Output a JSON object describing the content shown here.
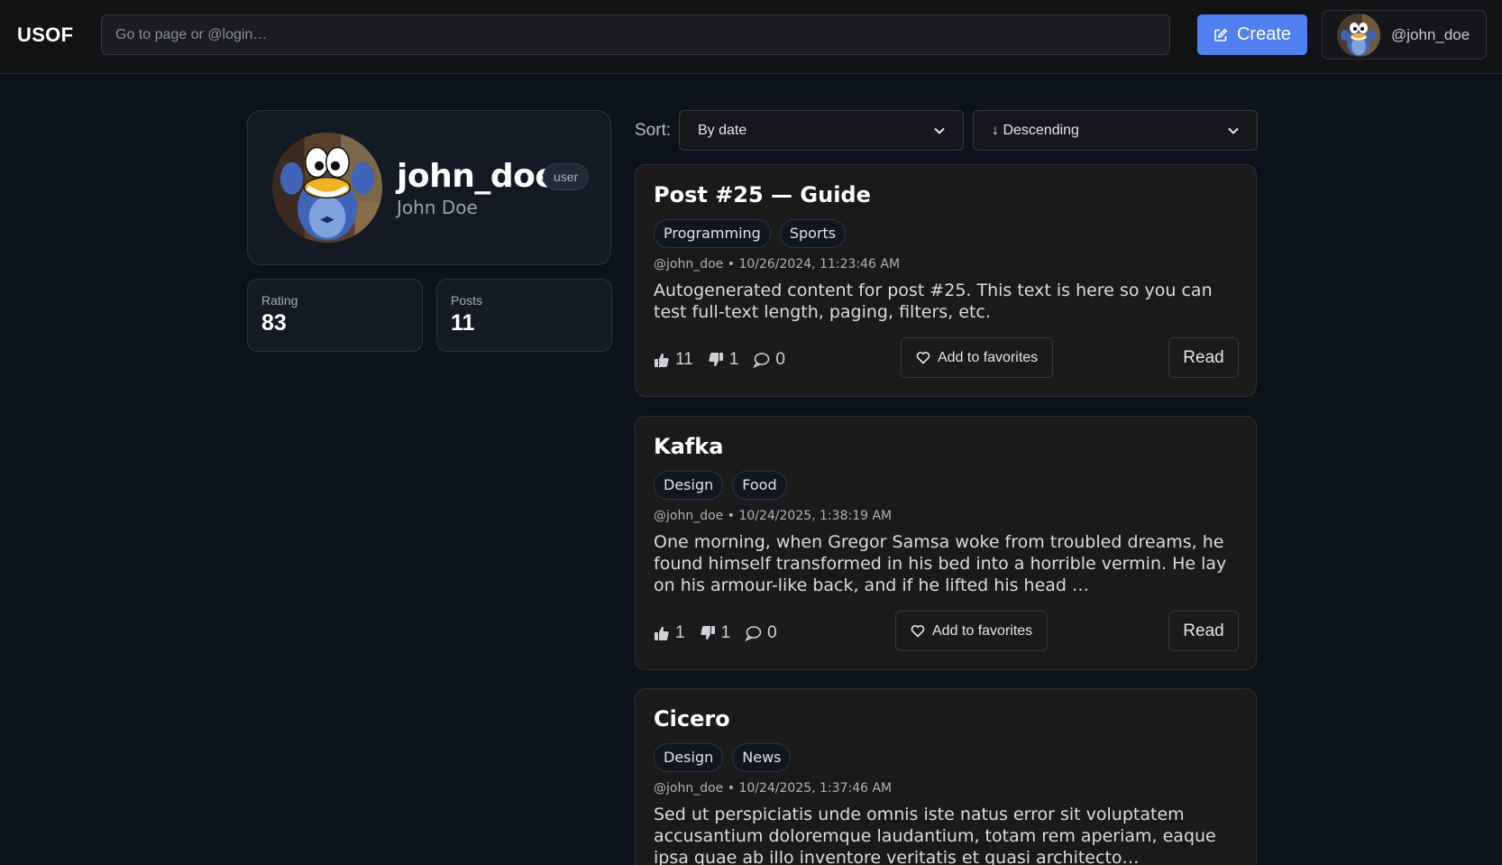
{
  "header": {
    "logo": "USOF",
    "search_placeholder": "Go to page or @login…",
    "create_label": "Create",
    "user_handle": "@john_doe"
  },
  "profile": {
    "username": "john_doe",
    "role": "user",
    "full_name": "John Doe",
    "rating_label": "Rating",
    "rating": "83",
    "posts_label": "Posts",
    "posts": "11"
  },
  "sort": {
    "label": "Sort:",
    "field": "By date",
    "order": "↓ Descending"
  },
  "posts": [
    {
      "title": "Post #25 — Guide",
      "tags": [
        "Programming",
        "Sports"
      ],
      "author": "@john_doe",
      "date": "10/26/2024, 11:23:46 AM",
      "excerpt": "Autogenerated content for post #25. This text is here so you can test full-text length, paging, filters, etc.",
      "likes": "11",
      "dislikes": "1",
      "comments": "0",
      "favorite_label": "Add to favorites",
      "read_label": "Read"
    },
    {
      "title": "Kafka",
      "tags": [
        "Design",
        "Food"
      ],
      "author": "@john_doe",
      "date": "10/24/2025, 1:38:19 AM",
      "excerpt": "One morning, when Gregor Samsa woke from troubled dreams, he found himself transformed in his bed into a horrible vermin. He lay on his armour-like back, and if he lifted his head …",
      "likes": "1",
      "dislikes": "1",
      "comments": "0",
      "favorite_label": "Add to favorites",
      "read_label": "Read"
    },
    {
      "title": "Cicero",
      "tags": [
        "Design",
        "News"
      ],
      "author": "@john_doe",
      "date": "10/24/2025, 1:37:46 AM",
      "excerpt": "Sed ut perspiciatis unde omnis iste natus error sit voluptatem accusantium doloremque laudantium, totam rem aperiam, eaque ipsa quae ab illo inventore veritatis et quasi architecto…"
    }
  ],
  "colors": {
    "accent": "#4f7ff0",
    "background": "#0c121b",
    "card": "#1a1a1b"
  },
  "icons": [
    "edit-icon",
    "thumbs-up-icon",
    "thumbs-down-icon",
    "comment-icon",
    "heart-icon",
    "chevron-down-icon"
  ]
}
